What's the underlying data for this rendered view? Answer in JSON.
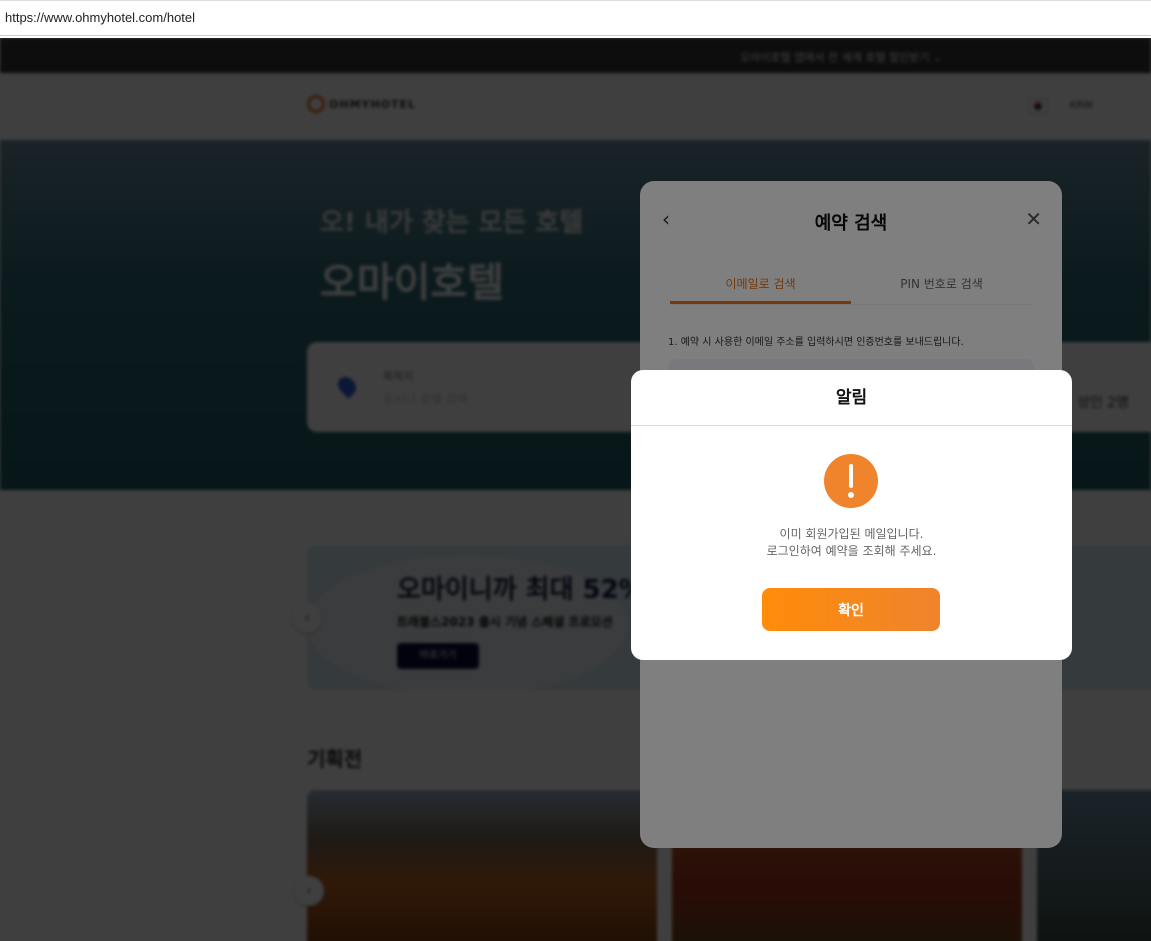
{
  "browser": {
    "url": "https://www.ohmyhotel.com/hotel"
  },
  "topbar": {
    "promo": "오마이호텔 앱에서 전 세계 호텔 할인받기 ⌄"
  },
  "header": {
    "logo": "OHMYHOTEL",
    "currency": "KRW"
  },
  "hero": {
    "subtitle": "오! 내가 찾는 모든 호텔",
    "title": "오마이호텔"
  },
  "search": {
    "destination_label": "목적지",
    "destination_placeholder": "도시나 호텔 검색",
    "guests": "성인 2명"
  },
  "banner": {
    "title": "오마이니까 최대 52%",
    "subtitle": "트래블스2023 출시 기념 스페셜 프로모션",
    "cta": "바로가기"
  },
  "section": {
    "title": "기획전"
  },
  "reservation_modal": {
    "title": "예약 검색",
    "back": "‹",
    "close": "✕",
    "tabs": [
      "이메일로 검색",
      "PIN 번호로 검색"
    ],
    "instruction": "1. 예약 시 사용한 이메일 주소를 입력하시면 인증번호를 보내드립니다."
  },
  "alert": {
    "title": "알림",
    "icon": "exclamation-icon",
    "line1": "이미 회원가입된 메일입니다.",
    "line2": "로그인하여 예약을 조회해 주세요.",
    "confirm": "확인",
    "accent": "#ef842d"
  }
}
